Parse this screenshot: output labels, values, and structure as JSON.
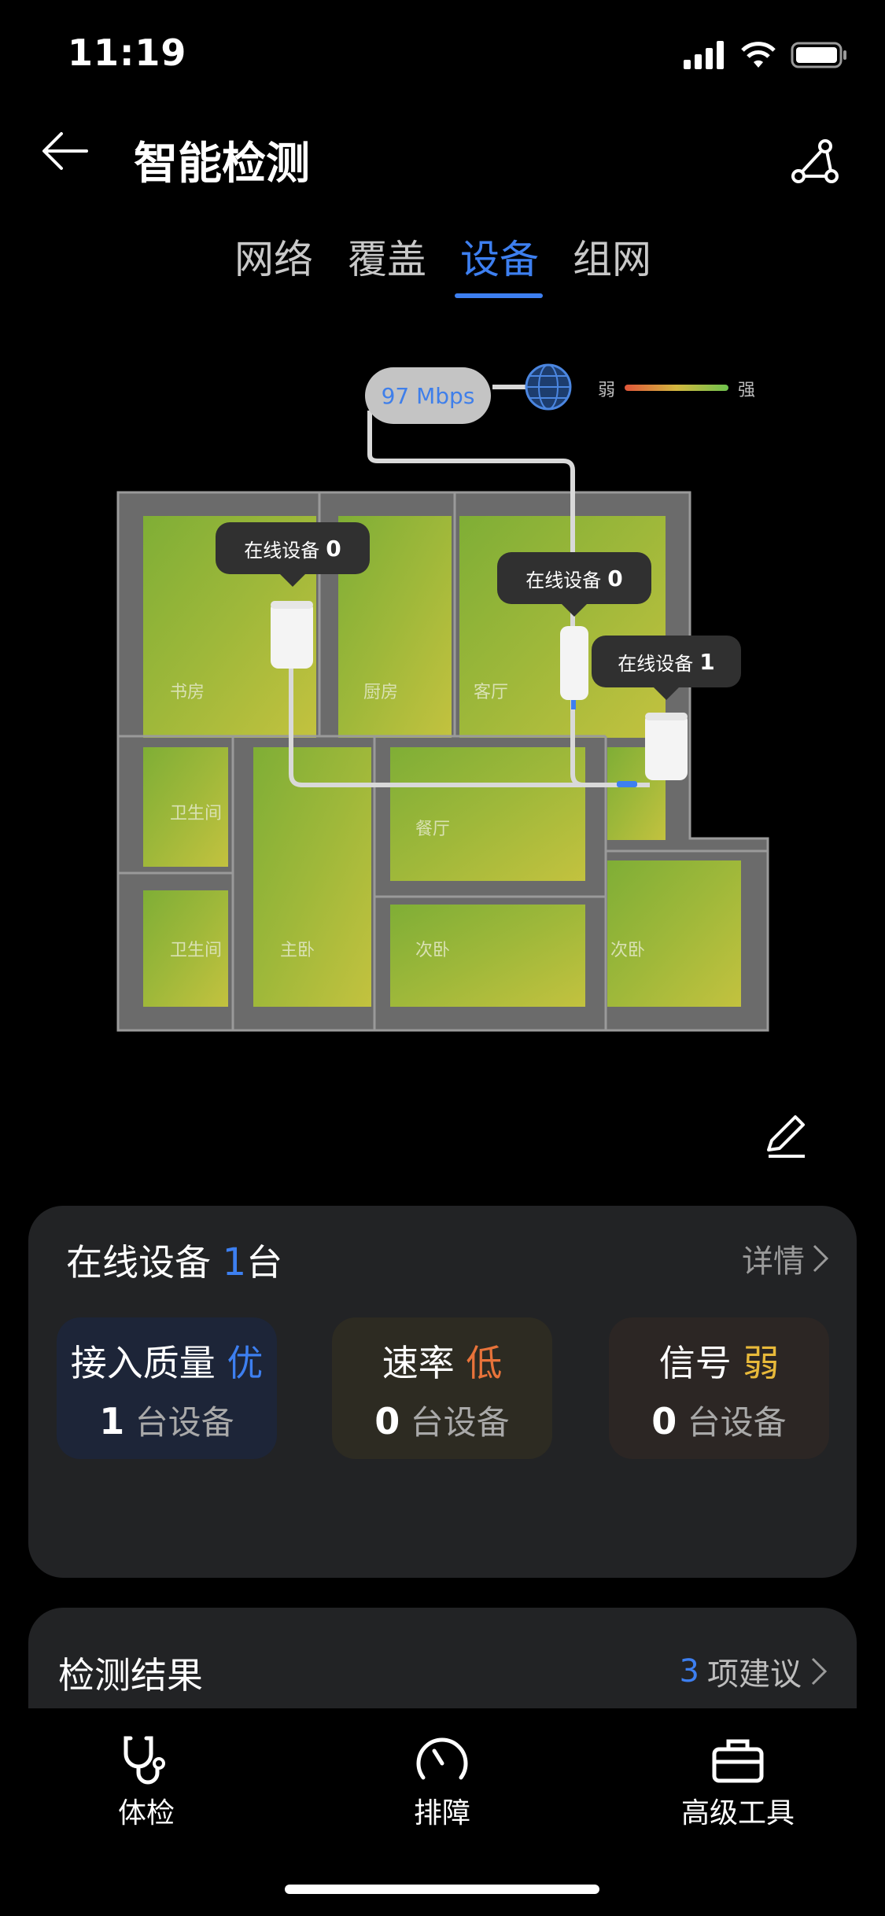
{
  "status_bar": {
    "time": "11:19"
  },
  "header": {
    "title": "智能检测"
  },
  "tabs": [
    {
      "label": "网络",
      "active": false
    },
    {
      "label": "覆盖",
      "active": false
    },
    {
      "label": "设备",
      "active": true
    },
    {
      "label": "组网",
      "active": false
    }
  ],
  "map": {
    "speed": "97 Mbps",
    "legend": {
      "weak": "弱",
      "strong": "强"
    },
    "rooms": [
      "书房",
      "厨房",
      "客厅",
      "卫生间",
      "餐厅",
      "卫生间",
      "主卧",
      "次卧",
      "次卧"
    ],
    "devices": [
      {
        "label": "在线设备",
        "count": "0"
      },
      {
        "label": "在线设备",
        "count": "0"
      },
      {
        "label": "在线设备",
        "count": "1"
      }
    ],
    "colors": {
      "heat": "#9bb53a",
      "wall": "#6e6e6e",
      "accent": "#3d7ff0"
    }
  },
  "online": {
    "title": "在线设备",
    "count": "1",
    "unit": "台",
    "detail": "详情",
    "stats": [
      {
        "label": "接入质量",
        "level": "优",
        "count": "1",
        "unit": "台设备",
        "level_color": "#3d7ff0",
        "bg": "#1d2538"
      },
      {
        "label": "速率",
        "level": "低",
        "count": "0",
        "unit": "台设备",
        "level_color": "#e8733a",
        "bg": "#2d2b22"
      },
      {
        "label": "信号",
        "level": "弱",
        "count": "0",
        "unit": "台设备",
        "level_color": "#e8b93a",
        "bg": "#2c2624"
      }
    ]
  },
  "result": {
    "title": "检测结果",
    "count": "3",
    "suffix": "项建议"
  },
  "bottom_nav": [
    {
      "label": "体检",
      "icon": "stethoscope-icon"
    },
    {
      "label": "排障",
      "icon": "gauge-icon"
    },
    {
      "label": "高级工具",
      "icon": "toolbox-icon"
    }
  ]
}
